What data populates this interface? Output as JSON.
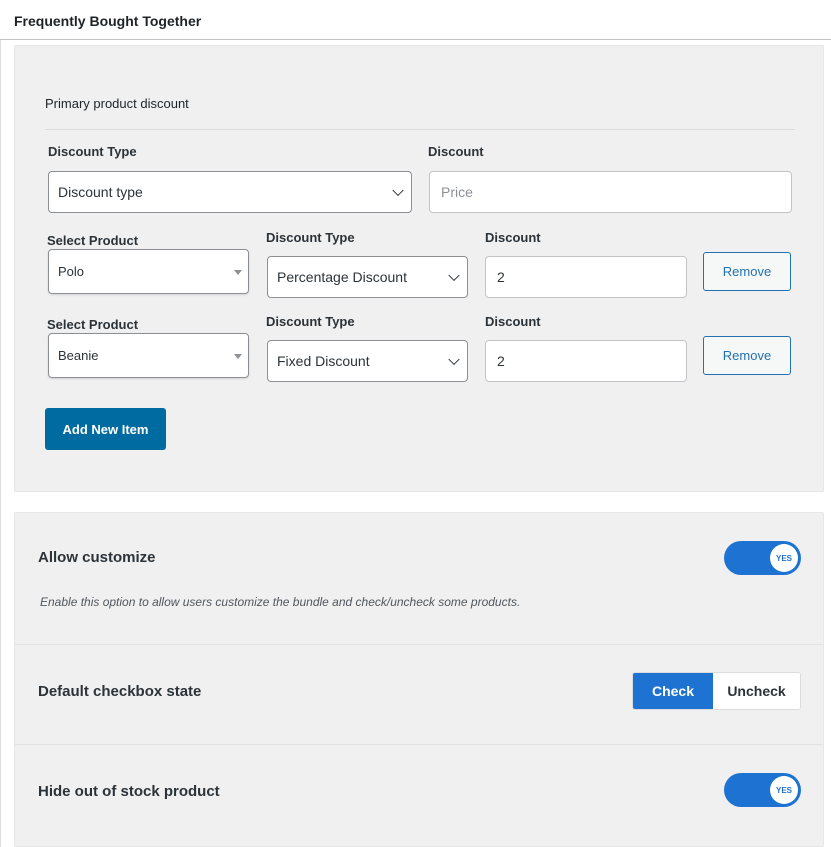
{
  "header": {
    "title": "Frequently Bought Together"
  },
  "primary": {
    "section_title": "Primary product discount",
    "discount_type_label": "Discount Type",
    "discount_type_value": "Discount type",
    "discount_label": "Discount",
    "discount_placeholder": "Price"
  },
  "items": [
    {
      "product_label": "Select Product",
      "product_value": "Polo",
      "type_label": "Discount Type",
      "type_value": "Percentage Discount",
      "discount_label": "Discount",
      "discount_value": "2",
      "remove_label": "Remove"
    },
    {
      "product_label": "Select Product",
      "product_value": "Beanie",
      "type_label": "Discount Type",
      "type_value": "Fixed Discount",
      "discount_label": "Discount",
      "discount_value": "2",
      "remove_label": "Remove"
    }
  ],
  "add_button": {
    "label": "Add New Item"
  },
  "settings": {
    "allow_customize": {
      "title": "Allow customize",
      "description": "Enable this option to allow users customize the bundle and check/uncheck some products.",
      "toggle_label": "YES"
    },
    "default_checkbox": {
      "title": "Default checkbox state",
      "check_label": "Check",
      "uncheck_label": "Uncheck",
      "selected": "Check"
    },
    "hide_out_of_stock": {
      "title": "Hide out of stock product",
      "toggle_label": "YES"
    }
  },
  "colors": {
    "accent": "#1e73d2",
    "add_button": "#006ba1",
    "remove_border": "#2271b1",
    "panel_bg": "#f0f0f1"
  }
}
